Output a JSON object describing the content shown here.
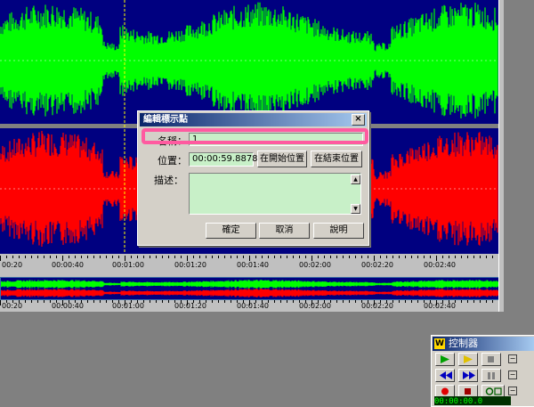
{
  "timeline": {
    "labels": [
      "00:20",
      "00:00:40",
      "00:01:00",
      "00:01:20",
      "00:01:40",
      "00:02:00",
      "00:02:20",
      "00:02:40"
    ],
    "overview_labels": [
      "00:20",
      "00:00:40",
      "00:01:00",
      "00:01:20",
      "00:01:40",
      "00:02:00",
      "00:02:20",
      "00:02:40"
    ]
  },
  "dialog": {
    "title": "編輯標示點",
    "close_glyph": "×",
    "name_label": "名稱：",
    "name_value": "1",
    "position_label": "位置：",
    "position_value": "00:00:59.88780",
    "at_start_button": "在開始位置",
    "at_end_button": "在結束位置",
    "description_label": "描述：",
    "description_value": "",
    "ok_button": "確定",
    "cancel_button": "取消",
    "help_button": "說明"
  },
  "controller": {
    "title": "控制器",
    "icon_glyph": "W",
    "time_readout": "00:00:00.0"
  },
  "colors": {
    "waveform_top": "#00ff00",
    "waveform_bottom": "#ff0000",
    "wave_background": "#000080",
    "highlight": "#ff5aa0"
  }
}
